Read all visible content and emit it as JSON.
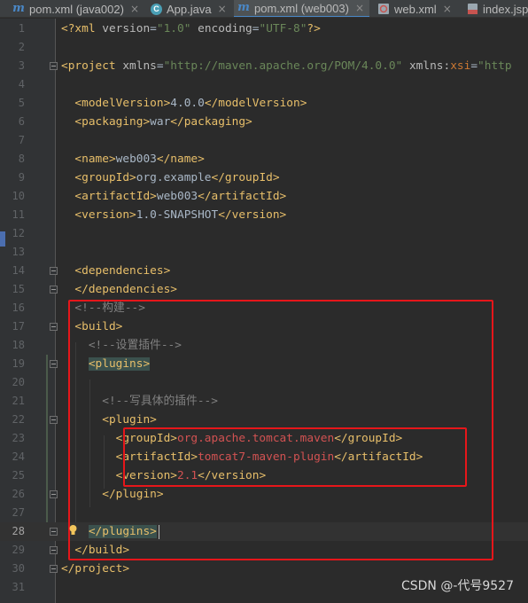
{
  "tabs": [
    {
      "icon": "maven-icon",
      "label": "pom.xml (java002)",
      "active": false
    },
    {
      "icon": "java-class-icon",
      "label": "App.java",
      "active": false
    },
    {
      "icon": "maven-icon",
      "label": "pom.xml (web003)",
      "active": true
    },
    {
      "icon": "web-xml-icon",
      "label": "web.xml",
      "active": false
    },
    {
      "icon": "jsp-icon",
      "label": "index.jsp",
      "active": false
    }
  ],
  "close_glyph": "×",
  "editor": {
    "current_line": 28,
    "lines": [
      {
        "n": "1",
        "segs": [
          [
            "t-tag",
            "<?xml "
          ],
          [
            "t-attr",
            "version"
          ],
          [
            "t-txt",
            "="
          ],
          [
            "t-str",
            "\"1.0\""
          ],
          [
            "t-attr",
            " encoding"
          ],
          [
            "t-txt",
            "="
          ],
          [
            "t-str",
            "\"UTF-8\""
          ],
          [
            "t-tag",
            "?>"
          ]
        ]
      },
      {
        "n": "2",
        "segs": []
      },
      {
        "n": "3",
        "segs": [
          [
            "t-tag",
            "<project "
          ],
          [
            "t-attr",
            "xmlns"
          ],
          [
            "t-txt",
            "="
          ],
          [
            "t-str",
            "\"http://maven.apache.org/POM/4.0.0\""
          ],
          [
            "t-attr",
            " xmlns:"
          ],
          [
            "t-red",
            "xsi"
          ],
          [
            "t-txt",
            "="
          ],
          [
            "t-str",
            "\"http"
          ]
        ]
      },
      {
        "n": "4",
        "segs": []
      },
      {
        "n": "5",
        "segs": [
          [
            "t-txt",
            "  "
          ],
          [
            "t-tag",
            "<modelVersion>"
          ],
          [
            "t-txt",
            "4.0.0"
          ],
          [
            "t-tag",
            "</modelVersion>"
          ]
        ]
      },
      {
        "n": "6",
        "segs": [
          [
            "t-txt",
            "  "
          ],
          [
            "t-tag",
            "<packaging>"
          ],
          [
            "t-txt",
            "war"
          ],
          [
            "t-tag",
            "</packaging>"
          ]
        ]
      },
      {
        "n": "7",
        "segs": []
      },
      {
        "n": "8",
        "segs": [
          [
            "t-txt",
            "  "
          ],
          [
            "t-tag",
            "<name>"
          ],
          [
            "t-txt",
            "web003"
          ],
          [
            "t-tag",
            "</name>"
          ]
        ]
      },
      {
        "n": "9",
        "segs": [
          [
            "t-txt",
            "  "
          ],
          [
            "t-tag",
            "<groupId>"
          ],
          [
            "t-txt",
            "org.example"
          ],
          [
            "t-tag",
            "</groupId>"
          ]
        ]
      },
      {
        "n": "10",
        "segs": [
          [
            "t-txt",
            "  "
          ],
          [
            "t-tag",
            "<artifactId>"
          ],
          [
            "t-txt",
            "web003"
          ],
          [
            "t-tag",
            "</artifactId>"
          ]
        ]
      },
      {
        "n": "11",
        "segs": [
          [
            "t-txt",
            "  "
          ],
          [
            "t-tag",
            "<version>"
          ],
          [
            "t-txt",
            "1.0-SNAPSHOT"
          ],
          [
            "t-tag",
            "</version>"
          ]
        ]
      },
      {
        "n": "12",
        "segs": []
      },
      {
        "n": "13",
        "segs": []
      },
      {
        "n": "14",
        "segs": [
          [
            "t-txt",
            "  "
          ],
          [
            "t-tag",
            "<dependencies>"
          ]
        ]
      },
      {
        "n": "15",
        "segs": [
          [
            "t-txt",
            "  "
          ],
          [
            "t-tag",
            "</dependencies>"
          ]
        ]
      },
      {
        "n": "16",
        "segs": [
          [
            "t-txt",
            "  "
          ],
          [
            "t-cmt",
            "<!--构建-->"
          ]
        ]
      },
      {
        "n": "17",
        "segs": [
          [
            "t-txt",
            "  "
          ],
          [
            "t-tag",
            "<build>"
          ]
        ]
      },
      {
        "n": "18",
        "segs": [
          [
            "t-txt",
            "    "
          ],
          [
            "t-cmt",
            "<!--设置插件-->"
          ]
        ]
      },
      {
        "n": "19",
        "segs": [
          [
            "t-txt",
            "    "
          ],
          [
            "t-tag hl",
            "<plugins>"
          ]
        ]
      },
      {
        "n": "20",
        "segs": []
      },
      {
        "n": "21",
        "segs": [
          [
            "t-txt",
            "      "
          ],
          [
            "t-cmt",
            "<!--写具体的插件-->"
          ]
        ]
      },
      {
        "n": "22",
        "segs": [
          [
            "t-txt",
            "      "
          ],
          [
            "t-tag",
            "<plugin>"
          ]
        ]
      },
      {
        "n": "23",
        "segs": [
          [
            "t-txt",
            "        "
          ],
          [
            "t-tag",
            "<groupId>"
          ],
          [
            "t-red2",
            "org.apache.tomcat.maven"
          ],
          [
            "t-tag",
            "</groupId>"
          ]
        ]
      },
      {
        "n": "24",
        "segs": [
          [
            "t-txt",
            "        "
          ],
          [
            "t-tag",
            "<artifactId>"
          ],
          [
            "t-red2",
            "tomcat7-maven-plugin"
          ],
          [
            "t-tag",
            "</artifactId>"
          ]
        ]
      },
      {
        "n": "25",
        "segs": [
          [
            "t-txt",
            "        "
          ],
          [
            "t-tag",
            "<version>"
          ],
          [
            "t-red2",
            "2.1"
          ],
          [
            "t-tag",
            "</version>"
          ]
        ]
      },
      {
        "n": "26",
        "segs": [
          [
            "t-txt",
            "      "
          ],
          [
            "t-tag",
            "</plugin>"
          ]
        ]
      },
      {
        "n": "27",
        "segs": []
      },
      {
        "n": "28",
        "segs": [
          [
            "t-txt",
            "    "
          ],
          [
            "t-tag hl",
            "</plugins>"
          ]
        ]
      },
      {
        "n": "29",
        "segs": [
          [
            "t-txt",
            "  "
          ],
          [
            "t-tag",
            "</build>"
          ]
        ]
      },
      {
        "n": "30",
        "segs": [
          [
            "t-tag",
            "</project>"
          ]
        ]
      },
      {
        "n": "31",
        "segs": []
      }
    ]
  },
  "watermark": "CSDN @-代号9527",
  "colors": {
    "annotation_box": "#e6161a",
    "editor_bg": "#2b2b2b",
    "gutter_bg": "#313335",
    "tag": "#e8bf6a",
    "string": "#6a8759",
    "comment": "#808080"
  }
}
